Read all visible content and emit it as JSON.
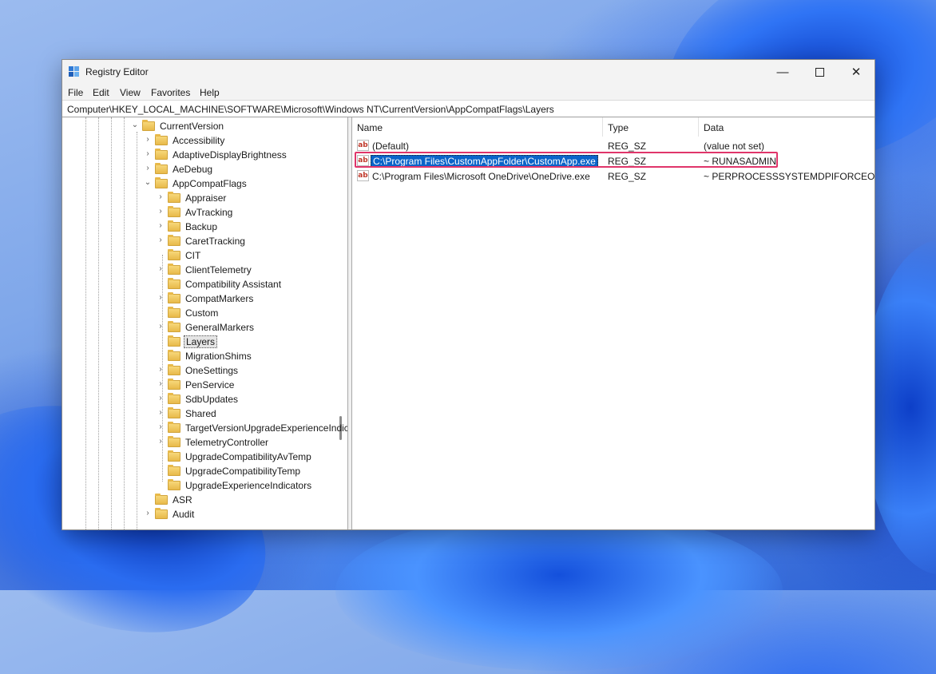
{
  "window": {
    "title": "Registry Editor",
    "controls": {
      "minimize": "—",
      "close": "✕"
    }
  },
  "menu": [
    "File",
    "Edit",
    "View",
    "Favorites",
    "Help"
  ],
  "address": "Computer\\HKEY_LOCAL_MACHINE\\SOFTWARE\\Microsoft\\Windows NT\\CurrentVersion\\AppCompatFlags\\Layers",
  "tree": [
    {
      "label": "CurrentVersion",
      "expanded": true
    },
    {
      "label": "Accessibility"
    },
    {
      "label": "AdaptiveDisplayBrightness"
    },
    {
      "label": "AeDebug"
    },
    {
      "label": "AppCompatFlags",
      "expanded": true
    },
    {
      "label": "Appraiser"
    },
    {
      "label": "AvTracking"
    },
    {
      "label": "Backup"
    },
    {
      "label": "CaretTracking"
    },
    {
      "label": "CIT"
    },
    {
      "label": "ClientTelemetry"
    },
    {
      "label": "Compatibility Assistant"
    },
    {
      "label": "CompatMarkers"
    },
    {
      "label": "Custom"
    },
    {
      "label": "GeneralMarkers"
    },
    {
      "label": "Layers",
      "selected": true
    },
    {
      "label": "MigrationShims"
    },
    {
      "label": "OneSettings"
    },
    {
      "label": "PenService"
    },
    {
      "label": "SdbUpdates"
    },
    {
      "label": "Shared"
    },
    {
      "label": "TargetVersionUpgradeExperienceIndicators"
    },
    {
      "label": "TelemetryController"
    },
    {
      "label": "UpgradeCompatibilityAvTemp"
    },
    {
      "label": "UpgradeCompatibilityTemp"
    },
    {
      "label": "UpgradeExperienceIndicators"
    },
    {
      "label": "ASR"
    },
    {
      "label": "Audit"
    }
  ],
  "columns": {
    "name": "Name",
    "type": "Type",
    "data": "Data"
  },
  "values": [
    {
      "name": "(Default)",
      "type": "REG_SZ",
      "data": "(value not set)",
      "icon": "string-value-icon"
    },
    {
      "name": "C:\\Program Files\\CustomAppFolder\\CustomApp.exe",
      "type": "REG_SZ",
      "data": "~ RUNASADMIN",
      "selected": true,
      "highlighted": true,
      "icon": "string-value-icon"
    },
    {
      "name": "C:\\Program Files\\Microsoft OneDrive\\OneDrive.exe",
      "type": "REG_SZ",
      "data": "~ PERPROCESSSYSTEMDPIFORCEOFF",
      "icon": "string-value-icon"
    }
  ],
  "colors": {
    "highlight_box": "#e0356a",
    "selection": "#0a64c9"
  }
}
